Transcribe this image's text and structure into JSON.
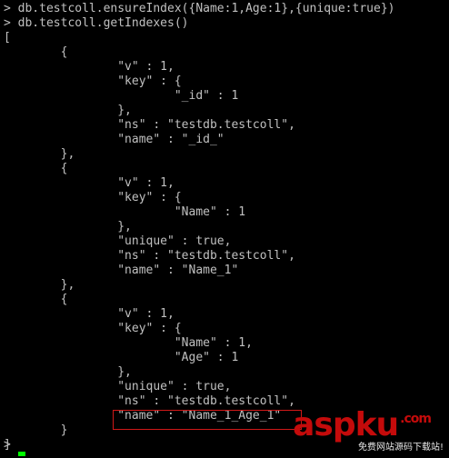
{
  "terminal": {
    "lines": [
      "> db.testcoll.ensureIndex({Name:1,Age:1},{unique:true})",
      "> db.testcoll.getIndexes()",
      "[",
      "        {",
      "                \"v\" : 1,",
      "                \"key\" : {",
      "                        \"_id\" : 1",
      "                },",
      "                \"ns\" : \"testdb.testcoll\",",
      "                \"name\" : \"_id_\"",
      "        },",
      "        {",
      "                \"v\" : 1,",
      "                \"key\" : {",
      "                        \"Name\" : 1",
      "                },",
      "                \"unique\" : true,",
      "                \"ns\" : \"testdb.testcoll\",",
      "                \"name\" : \"Name_1\"",
      "        },",
      "        {",
      "                \"v\" : 1,",
      "                \"key\" : {",
      "                        \"Name\" : 1,",
      "                        \"Age\" : 1",
      "                },",
      "                \"unique\" : true,",
      "                \"ns\" : \"testdb.testcoll\",",
      "                \"name\" : \"Name_1_Age_1\"",
      "        }",
      "]"
    ],
    "prompt": ">",
    "cursor_color": "#00ff00",
    "text_color": "#c0c0c0",
    "background": "#000000",
    "highlight_color": "#d01818"
  },
  "watermark": {
    "logo_text": "aspku",
    "logo_suffix": ".com",
    "tagline": "免费网站源码下载站!",
    "color": "#c40b0b"
  }
}
